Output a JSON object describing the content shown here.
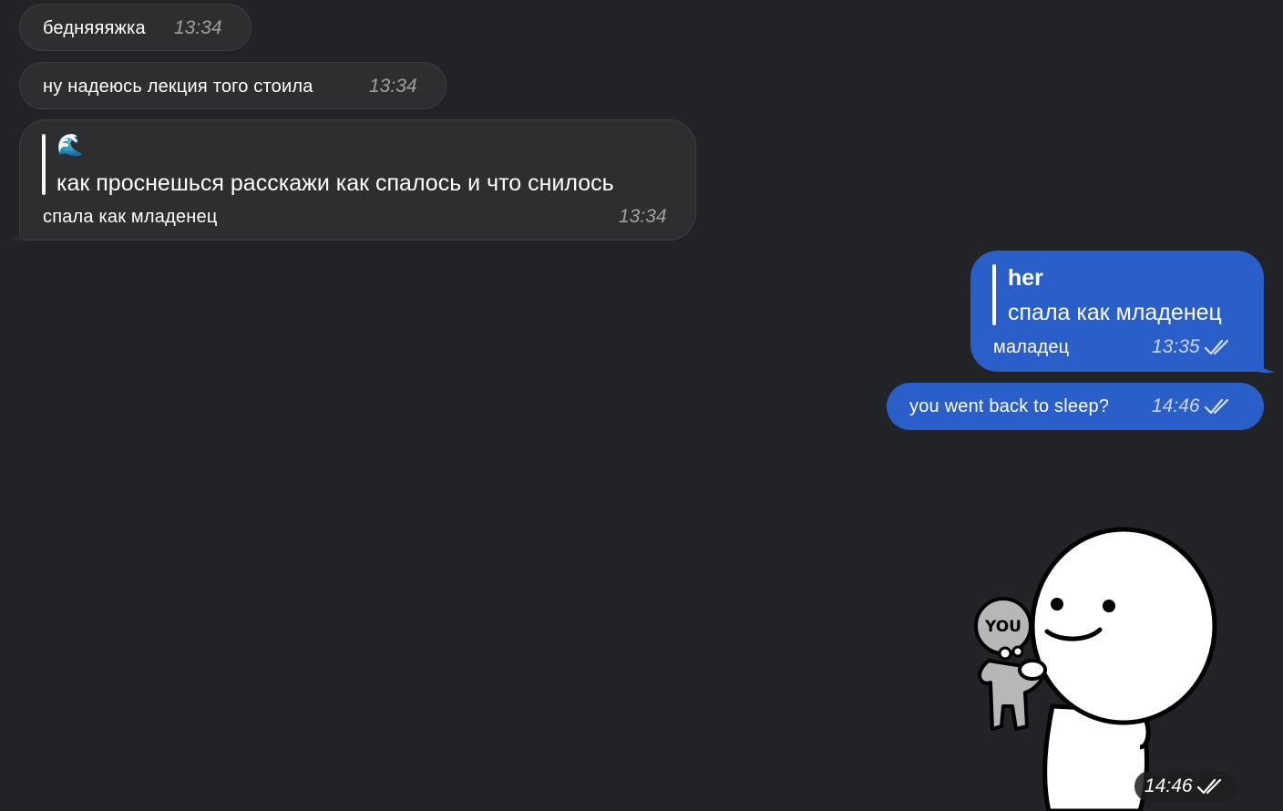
{
  "messages": [
    {
      "direction": "incoming",
      "text": "бедняяяжка",
      "time": "13:34"
    },
    {
      "direction": "incoming",
      "text": "ну надеюсь лекция того стоила",
      "time": "13:34"
    },
    {
      "direction": "incoming",
      "reply": {
        "emoji": "🌊",
        "text": "как проснешься расскажи как спалось и что снилось"
      },
      "text": "спала как младенец",
      "time": "13:34"
    },
    {
      "direction": "outgoing",
      "reply": {
        "author": "her",
        "text": "спала как младенец"
      },
      "text": "маладец",
      "time": "13:35",
      "status": "read"
    },
    {
      "direction": "outgoing",
      "text": "you went back to sleep?",
      "time": "14:46",
      "status": "read"
    },
    {
      "direction": "outgoing",
      "type": "sticker",
      "sticker_label": "YOU",
      "time": "14:46",
      "status": "read"
    }
  ],
  "colors": {
    "background": "#212326",
    "incoming_bubble": "#2d2e30",
    "outgoing_bubble": "#2a5ec9"
  }
}
